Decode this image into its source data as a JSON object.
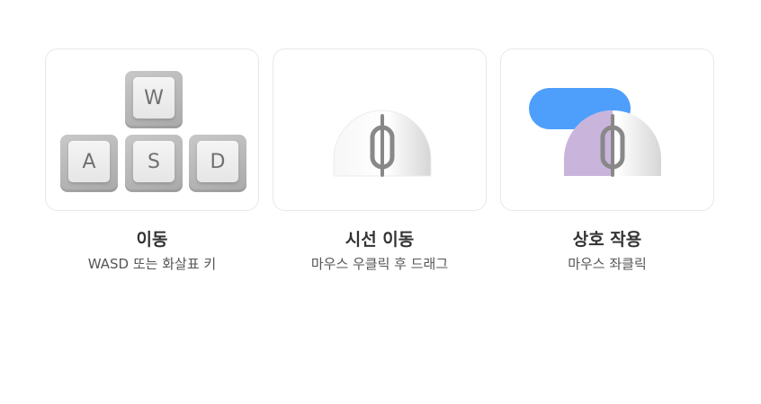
{
  "controls": [
    {
      "title": "이동",
      "description": "WASD 또는 화살표 키",
      "keys": [
        "W",
        "A",
        "S",
        "D"
      ]
    },
    {
      "title": "시선 이동",
      "description": "마우스 우클릭 후 드래그",
      "highlight": "right-button"
    },
    {
      "title": "상호 작용",
      "description": "마우스 좌클릭",
      "highlight": "left-button"
    }
  ],
  "colors": {
    "accent_blue": "#4e9ffb",
    "highlight_purple": "#c9b5dc",
    "key_gray": "#b5b5b5",
    "mouse_outline": "#888888"
  }
}
